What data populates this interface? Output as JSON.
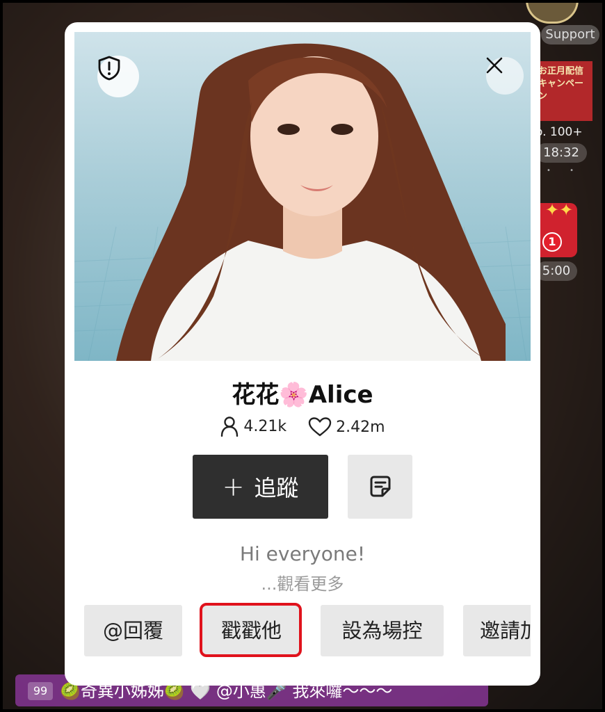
{
  "background": {
    "support_label": "Support",
    "promo_text": "お正月配信キャンペーン",
    "promo_rank": "o. 100+",
    "promo_time": "18:32",
    "gift_badge_count": "1",
    "gift_time": "5:00",
    "chat": {
      "level": "99",
      "message": "🥝奇異小姊姊🥝 🤍 @小惠🎤 我來囉～～～"
    }
  },
  "profile_card": {
    "name": "花花🌸Alice",
    "followers": "4.21k",
    "likes": "2.42m",
    "follow_label": "追蹤",
    "follow_plus": "+",
    "bio": "Hi everyone!",
    "see_more": "...觀看更多",
    "actions": [
      {
        "label": "@回覆"
      },
      {
        "label": "戳戳他"
      },
      {
        "label": "設為場控"
      },
      {
        "label": "邀請加"
      }
    ],
    "highlighted_action": "戳戳他",
    "icons": {
      "shield": "shield-icon",
      "close": "close-icon",
      "followers": "person-icon",
      "likes": "heart-icon",
      "note": "note-icon"
    }
  },
  "colors": {
    "follow_button": "#2f2f2f",
    "secondary_button": "#e8e8e8",
    "highlight_border": "#e0121c",
    "chat_strip": "#9b3caf"
  }
}
